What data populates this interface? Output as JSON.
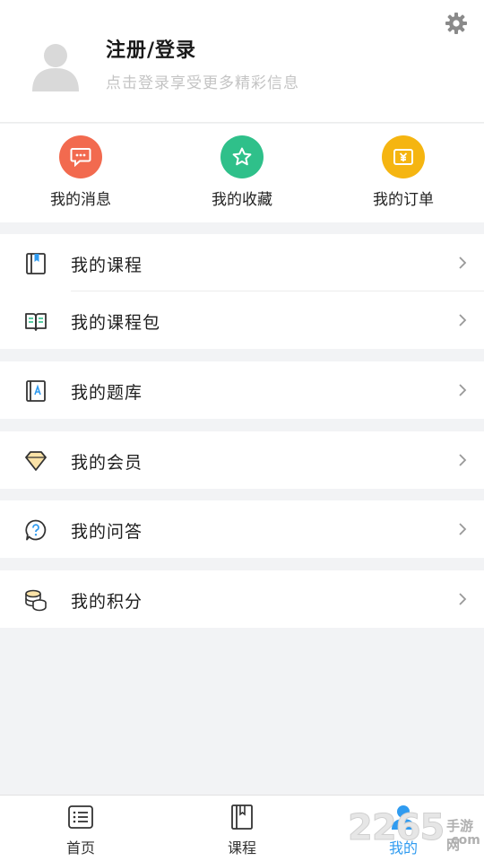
{
  "profile": {
    "title": "注册/登录",
    "subtitle": "点击登录享受更多精彩信息"
  },
  "quick_actions": [
    {
      "label": "我的消息",
      "icon": "message-icon",
      "color": "#f26a4f"
    },
    {
      "label": "我的收藏",
      "icon": "star-icon",
      "color": "#2fc08a"
    },
    {
      "label": "我的订单",
      "icon": "yuan-icon",
      "color": "#f5b511"
    }
  ],
  "menu": [
    {
      "label": "我的课程",
      "icon": "book-icon"
    },
    {
      "label": "我的课程包",
      "icon": "open-book-icon"
    },
    {
      "label": "我的题库",
      "icon": "question-bank-icon"
    },
    {
      "label": "我的会员",
      "icon": "diamond-icon"
    },
    {
      "label": "我的问答",
      "icon": "question-icon"
    },
    {
      "label": "我的积分",
      "icon": "coins-icon"
    }
  ],
  "tabbar": {
    "items": [
      {
        "label": "首页",
        "icon": "home-list-icon"
      },
      {
        "label": "课程",
        "icon": "course-book-icon"
      },
      {
        "label": "我的",
        "icon": "user-icon",
        "active": true
      }
    ]
  },
  "watermark": {
    "number": "2265",
    "cn": "手游网",
    "domain": ".com"
  },
  "colors": {
    "accent": "#2f9bf0",
    "background": "#f2f3f5"
  }
}
